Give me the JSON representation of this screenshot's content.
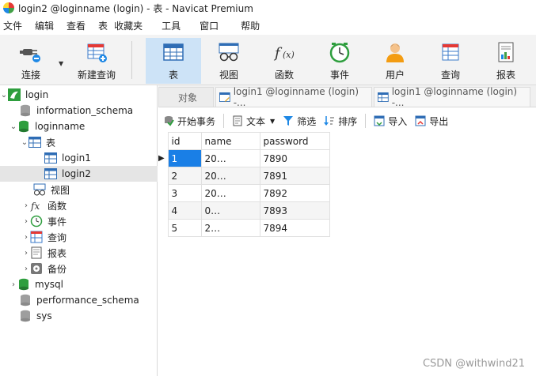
{
  "window": {
    "title": "login2 @loginname (login) - 表 - Navicat Premium"
  },
  "menu": [
    "文件",
    "编辑",
    "查看",
    "表",
    "收藏夹",
    "工具",
    "窗口",
    "帮助"
  ],
  "toolbar": {
    "connect": "连接",
    "new_query": "新建查询",
    "table": "表",
    "view": "视图",
    "function": "函数",
    "event": "事件",
    "user": "用户",
    "query": "查询",
    "report": "报表"
  },
  "tree": {
    "login": "login",
    "information_schema": "information_schema",
    "loginname": "loginname",
    "tables": "表",
    "login1": "login1",
    "login2": "login2",
    "views": "视图",
    "functions": "函数",
    "events": "事件",
    "queries": "查询",
    "reports": "报表",
    "backups": "备份",
    "mysql": "mysql",
    "performance_schema": "performance_schema",
    "sys": "sys"
  },
  "tabs": {
    "objects": "对象",
    "tab1": "login1 @loginname (login) -...",
    "tab2": "login1 @loginname (login) -..."
  },
  "subtoolbar": {
    "begin_transaction": "开始事务",
    "text": "文本",
    "filter": "筛选",
    "sort": "排序",
    "import": "导入",
    "export": "导出"
  },
  "grid": {
    "columns": [
      "id",
      "name",
      "password"
    ],
    "rows": [
      [
        "1",
        "20…",
        "7890"
      ],
      [
        "2",
        "20…",
        "7891"
      ],
      [
        "3",
        "20…",
        "7892"
      ],
      [
        "4",
        "0…",
        "7893"
      ],
      [
        "5",
        "2…",
        "7894"
      ]
    ]
  },
  "watermark": "CSDN @withwind21",
  "colors": {
    "accent": "#1a7fe6",
    "active_tool": "#cde3f7",
    "db_green": "#2e9e3e"
  }
}
